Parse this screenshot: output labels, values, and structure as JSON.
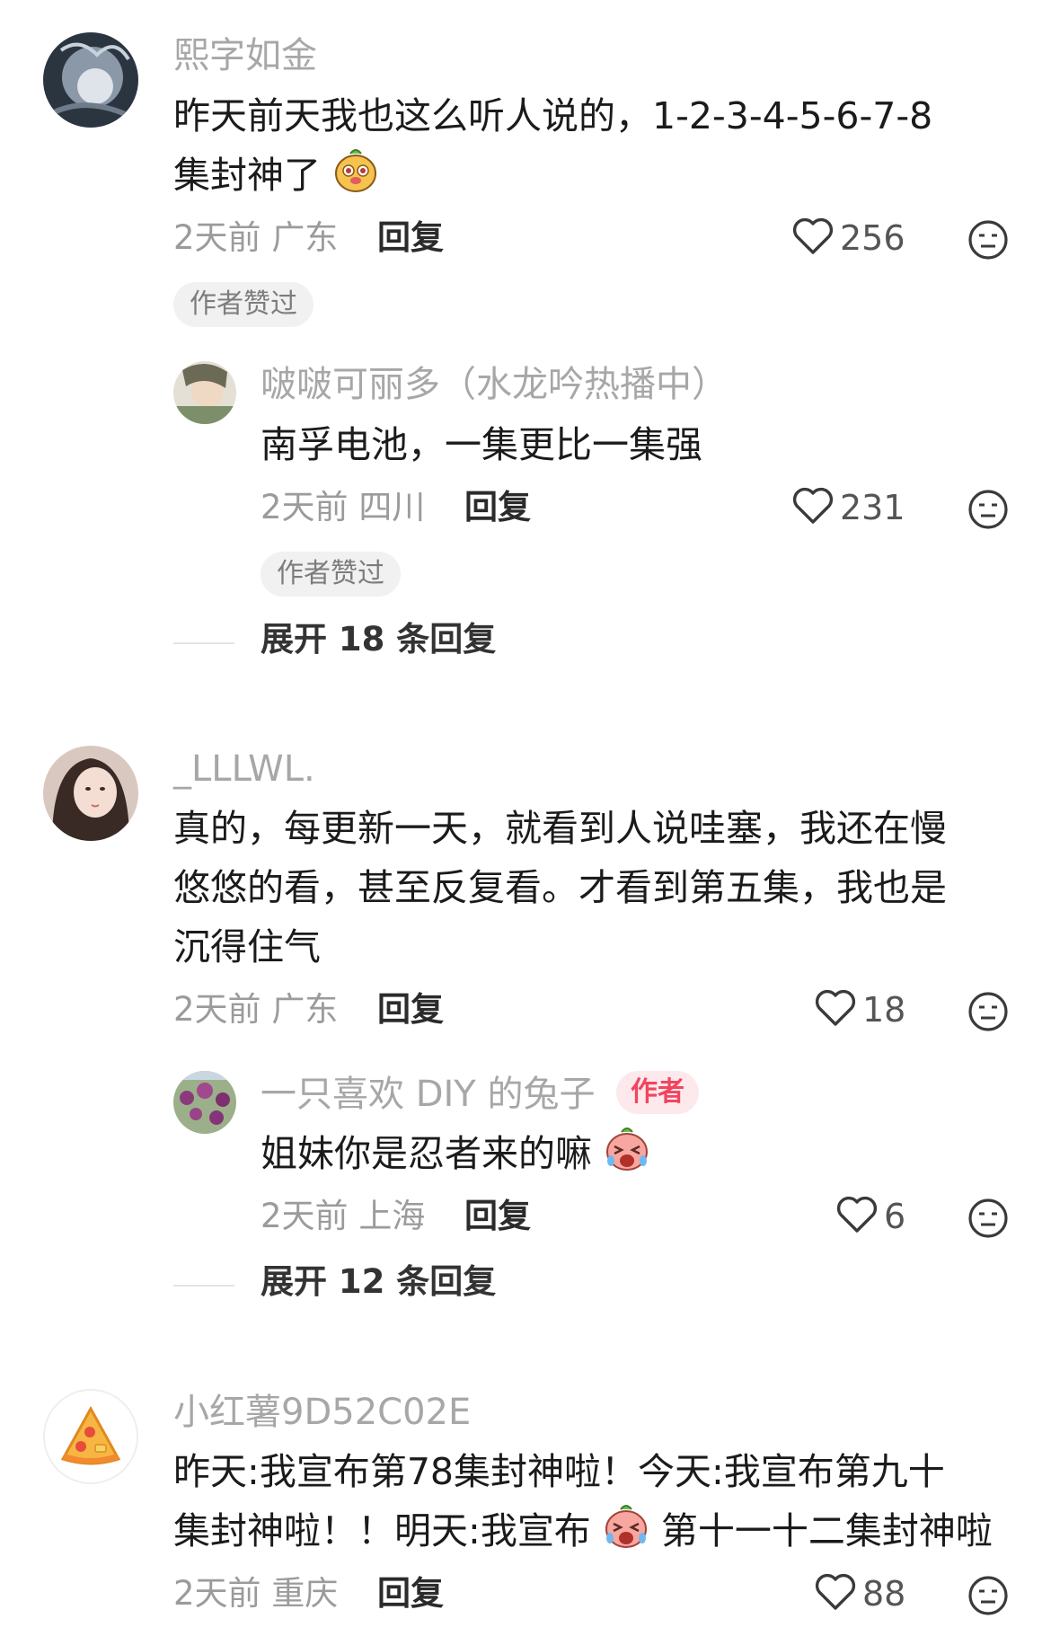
{
  "comments": [
    {
      "username": "熙字如金",
      "text_line1": "昨天前天我也这么听人说的，1-2-3-4-5-6-7-8",
      "text_line2": "集封神了",
      "time": "2天前",
      "location": "广东",
      "reply_label": "回复",
      "likes": "256",
      "badge": "作者赞过",
      "replies": [
        {
          "username": "啵啵可丽多（水龙吟热播中）",
          "text": "南孚电池，一集更比一集强",
          "time": "2天前",
          "location": "四川",
          "reply_label": "回复",
          "likes": "231",
          "badge": "作者赞过"
        }
      ],
      "expand_text": "展开 18 条回复"
    },
    {
      "username": "_LLLWL.",
      "text_line1": "真的，每更新一天，就看到人说哇塞，我还在慢",
      "text_line2": "悠悠的看，甚至反复看。才看到第五集，我也是",
      "text_line3": "沉得住气",
      "time": "2天前",
      "location": "广东",
      "reply_label": "回复",
      "likes": "18",
      "replies": [
        {
          "username": "一只喜欢 DIY 的兔子",
          "author_tag": "作者",
          "text": "姐妹你是忍者来的嘛",
          "time": "2天前",
          "location": "上海",
          "reply_label": "回复",
          "likes": "6"
        }
      ],
      "expand_text": "展开 12 条回复"
    },
    {
      "username": "小红薯9D52C02E",
      "text_line1": "昨天:我宣布第78集封神啦！今天:我宣布第九十",
      "text_line2a": "集封神啦！！明天:我宣布",
      "text_line2b": "第十一十二集封神啦",
      "time": "2天前",
      "location": "重庆",
      "reply_label": "回复",
      "likes": "88"
    }
  ],
  "icons": {
    "like": "heart-outline-icon",
    "react": "neutral-face-icon",
    "emoji_1": "dog-emoji",
    "emoji_2": "crying-emoji",
    "avatar_3": "pizza-icon"
  },
  "colors": {
    "username": "#a7a7a7",
    "meta": "#9b9b9b",
    "author_tag_text": "#f2455f",
    "author_tag_bg": "#fde9ec",
    "badge_bg": "#f1f1f1"
  }
}
